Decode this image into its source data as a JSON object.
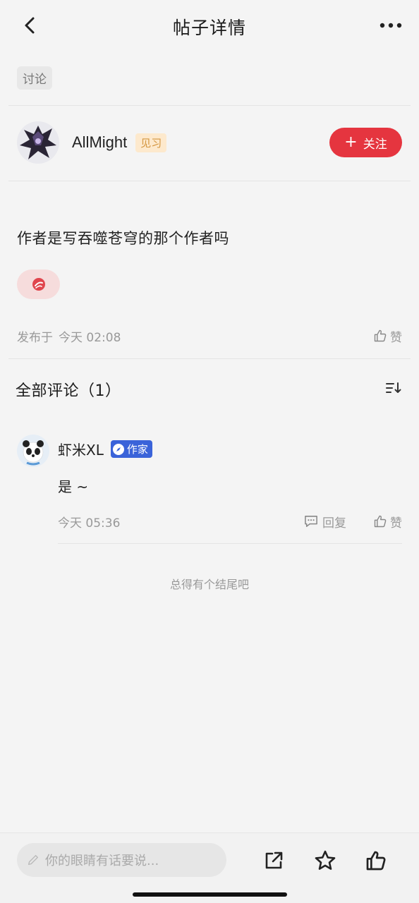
{
  "header": {
    "title": "帖子详情",
    "back_icon": "back-arrow-icon",
    "more_icon": "more-dots-icon"
  },
  "post": {
    "tag": "讨论",
    "author": {
      "name": "AllMight",
      "level": "见习",
      "follow_label": "关注"
    },
    "content": "作者是写吞噬苍穹的那个作者吗",
    "published_prefix": "发布于",
    "published_time": "今天 02:08",
    "like_label": "赞"
  },
  "comments": {
    "title": "全部评论（1）",
    "items": [
      {
        "name": "虾米XL",
        "badge": "作家",
        "text": "是 ~",
        "time": "今天 05:36",
        "reply_label": "回复",
        "like_label": "赞"
      }
    ]
  },
  "end_text": "总得有个结尾吧",
  "bottom_bar": {
    "input_placeholder": "你的眼睛有话要说..."
  },
  "colors": {
    "accent_red": "#e5353f",
    "badge_blue": "#3a63d9",
    "level_badge_bg": "#fde9cd"
  }
}
